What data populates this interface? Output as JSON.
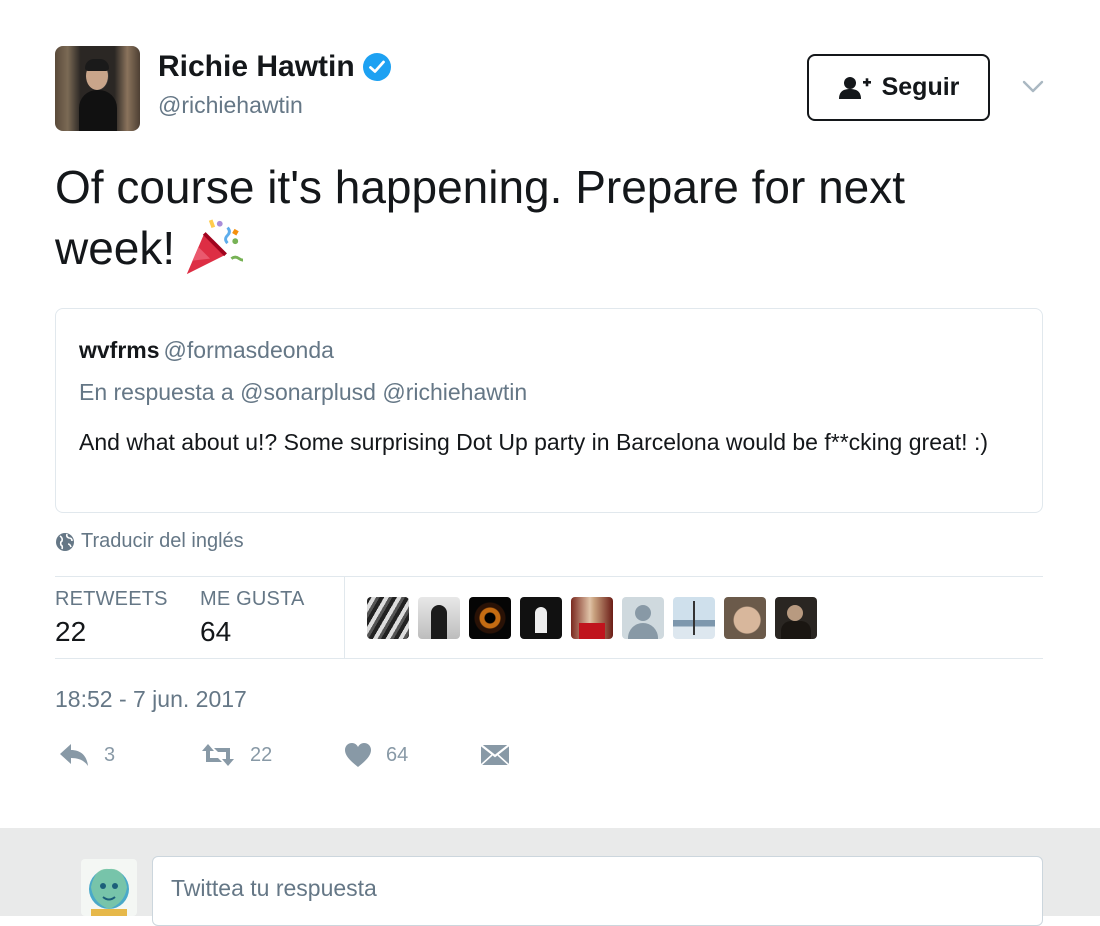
{
  "author": {
    "name": "Richie Hawtin",
    "handle": "@richiehawtin",
    "verified": true
  },
  "follow_button": {
    "label": "Seguir"
  },
  "tweet": {
    "text_line1": "Of course it's happening.  Prepare for next",
    "text_line2": "week!",
    "emoji": "party-popper"
  },
  "quoted_tweet": {
    "name": "wvfrms",
    "handle": "@formasdeonda",
    "reply_prefix": "En respuesta a",
    "reply_to": "@sonarplusd @richiehawtin",
    "text": "And what about u!? Some surprising Dot Up party in Barcelona would be f**cking great! :)"
  },
  "translate": {
    "label": "Traducir del inglés"
  },
  "stats": {
    "retweets_label": "RETWEETS",
    "retweets_value": "22",
    "likes_label": "ME GUSTA",
    "likes_value": "64"
  },
  "timestamp": "18:52 - 7 jun. 2017",
  "actions": {
    "reply_count": "3",
    "retweet_count": "22",
    "like_count": "64"
  },
  "reply_box": {
    "placeholder": "Twittea tu respuesta"
  },
  "colors": {
    "verified_blue": "#1da1f2",
    "secondary_text": "#657786",
    "action_gray": "#8899a6",
    "border": "#e1e8ed",
    "reply_bar_bg": "#e9eaea"
  }
}
